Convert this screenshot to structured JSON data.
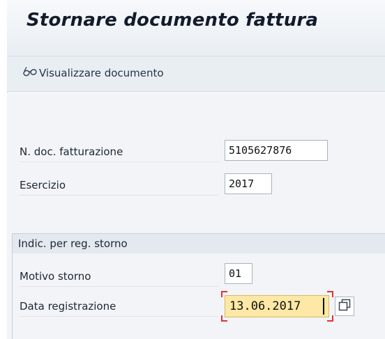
{
  "window": {
    "title": "Stornare documento fattura"
  },
  "toolbar": {
    "display_document_label": "Visualizzare documento",
    "display_document_icon": "glasses-icon"
  },
  "fields": {
    "billing_doc_label": "N. doc. fatturazione",
    "billing_doc_value": "5105627876",
    "fiscal_year_label": "Esercizio",
    "fiscal_year_value": "2017"
  },
  "reversal_group": {
    "title": "Indic. per reg. storno",
    "reason_label": "Motivo storno",
    "reason_value": "01",
    "posting_date_label": "Data registrazione",
    "posting_date_value": "13.06.2017",
    "value_help_icon": "value-help-icon"
  },
  "colors": {
    "title_text": "#121c2b",
    "content_bg": "#f2f4f7",
    "focused_field_bg": "#fde8a5",
    "focus_marker": "#e0303a"
  }
}
